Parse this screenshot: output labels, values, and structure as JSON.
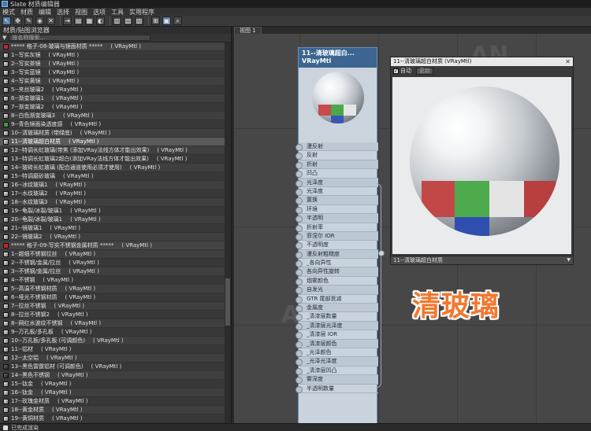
{
  "window": {
    "title": "Slate 材质编辑器"
  },
  "menu": [
    "模式",
    "材质",
    "编辑",
    "选择",
    "视图",
    "选项",
    "工具",
    "实用程序"
  ],
  "toolbar": {
    "buttons": [
      "选择",
      "平移",
      "吸管",
      "指定",
      "删除",
      "移动子对象",
      "隐藏",
      "显示背景",
      "显示贴图",
      "布局",
      "全部布局",
      "子对象",
      "导航",
      "搜索"
    ]
  },
  "left_panel": {
    "header": "材质/贴图浏览器",
    "search_placeholder": "按名称搜索...",
    "items": [
      {
        "label": "***** 格子-08-玻璃与镜面材质 *****",
        "type": "( VRayMtl )",
        "swatch": "red",
        "group": true
      },
      {
        "label": "1--写实灰镜",
        "type": "( VRayMtl )",
        "swatch": "sphere"
      },
      {
        "label": "2--写实茶镜",
        "type": "( VRayMtl )",
        "swatch": "sphere"
      },
      {
        "label": "3--写实蓝镜",
        "type": "( VRayMtl )",
        "swatch": "sphere"
      },
      {
        "label": "4--写实黄镜",
        "type": "( VRayMtl )",
        "swatch": "sphere"
      },
      {
        "label": "5--夹丝玻璃2",
        "type": "( VRayMtl )",
        "swatch": "sphere"
      },
      {
        "label": "6--渐变玻璃1",
        "type": "( VRayMtl )",
        "swatch": "sphere"
      },
      {
        "label": "7--渐变玻璃2",
        "type": "( VRayMtl )",
        "swatch": "sphere"
      },
      {
        "label": "8--白色渐变玻璃3",
        "type": "( VRayMtl )",
        "swatch": "sphere"
      },
      {
        "label": "9--青色镜面染透度感",
        "type": "( VRayMtl )",
        "swatch": "green"
      },
      {
        "label": "10--清玻璃材质 (带绿底)",
        "type": "( VRayMtl )",
        "swatch": "sphere"
      },
      {
        "label": "11--清玻璃超白材质",
        "type": "( VRayMtl )",
        "swatch": "sphere",
        "selected": true
      },
      {
        "label": "12--特调长虹玻璃(带焦 (添加VRay法线方体才能出效果)",
        "type": "( VRayMtl )",
        "swatch": "sphere"
      },
      {
        "label": "13--特调长虹玻璃2超白(添加VRay法线方体才能出效果)",
        "type": "( VRayMtl )",
        "swatch": "sphere"
      },
      {
        "label": "14--玻砖长虹玻璃 (配合通道使用必须才使用)",
        "type": "( VRayMtl )",
        "swatch": "sphere"
      },
      {
        "label": "15--特调磨砂玻璃",
        "type": "( VRayMtl )",
        "swatch": "sphere"
      },
      {
        "label": "16--冰纹玻璃1",
        "type": "( VRayMtl )",
        "swatch": "sphere"
      },
      {
        "label": "17--水纹玻璃2",
        "type": "( VRayMtl )",
        "swatch": "sphere"
      },
      {
        "label": "18--水纹玻璃3",
        "type": "( VRayMtl )",
        "swatch": "sphere"
      },
      {
        "label": "19--龟裂/冰裂/玻璃1",
        "type": "( VRayMtl )",
        "swatch": "sphere"
      },
      {
        "label": "20--龟裂/冰裂/玻璃1",
        "type": "( VRayMtl )",
        "swatch": "sphere"
      },
      {
        "label": "21--镜玻璃1",
        "type": "( VRayMtl )",
        "swatch": "sphere"
      },
      {
        "label": "22--镜玻璃2",
        "type": "( VRayMtl )",
        "swatch": "sphere"
      },
      {
        "label": "***** 格子-09-写实不锈钢金属材质 *****",
        "type": "( VRayMtl )",
        "swatch": "red",
        "group": true
      },
      {
        "label": "1--超细不锈钢拉丝",
        "type": "( VRayMtl )",
        "swatch": "sphere"
      },
      {
        "label": "2--不锈钢/金属/拉丝",
        "type": "( VRayMtl )",
        "swatch": "sphere"
      },
      {
        "label": "3--不锈钢/金属/拉丝",
        "type": "( VRayMtl )",
        "swatch": "sphere"
      },
      {
        "label": "4--不锈钢",
        "type": "( VRayMtl )",
        "swatch": "sphere"
      },
      {
        "label": "5--高温不锈钢材质",
        "type": "( VRayMtl )",
        "swatch": "sphere"
      },
      {
        "label": "6--哑光不锈钢材质",
        "type": "( VRayMtl )",
        "swatch": "sphere"
      },
      {
        "label": "7--拉丝不锈钢",
        "type": "( VRayMtl )",
        "swatch": "sphere"
      },
      {
        "label": "8--拉丝不锈钢2",
        "type": "( VRayMtl )",
        "swatch": "sphere"
      },
      {
        "label": "8--网红水波纹不锈钢",
        "type": "( VRayMtl )",
        "swatch": "sphere"
      },
      {
        "label": "9--万孔板/多孔板",
        "type": "( VRayMtl )",
        "swatch": "sphere"
      },
      {
        "label": "10--万孔板/多孔板 (可调颜色)",
        "type": "( VRayMtl )",
        "swatch": "sphere"
      },
      {
        "label": "11--铝材",
        "type": "( VRayMtl )",
        "swatch": "sphere"
      },
      {
        "label": "12--太空铝",
        "type": "( VRayMtl )",
        "swatch": "sphere"
      },
      {
        "label": "13--黑色雷霆铝材 (可调颜色)",
        "type": "( VRayMtl )",
        "swatch": "dark"
      },
      {
        "label": "14--黑色不锈钢",
        "type": "( VRayMtl )",
        "swatch": "dark"
      },
      {
        "label": "15--钛金",
        "type": "( VRayMtl )",
        "swatch": "sphere"
      },
      {
        "label": "16--钛金",
        "type": "( VRayMtl )",
        "swatch": "sphere"
      },
      {
        "label": "17--玫瑰金材质",
        "type": "( VRayMtl )",
        "swatch": "sphere"
      },
      {
        "label": "18--黄金材质",
        "type": "( VRayMtl )",
        "swatch": "sphere"
      },
      {
        "label": "19--黄铜材质",
        "type": "( VRayMtl )",
        "swatch": "sphere"
      },
      {
        "label": "20--香槟金材质",
        "type": "( VRayMtl )",
        "swatch": "sphere"
      }
    ]
  },
  "view_tab": "视图 1",
  "node": {
    "title": "11--清玻璃超白...",
    "subtitle": "VRayMtl",
    "slots": [
      "漫反射",
      "反射",
      "折射",
      "凹凸",
      "光泽度",
      "光泽度",
      "置换",
      "环境",
      "半透明",
      "折射率",
      "菲涅尔 IOR",
      "不透明度",
      "漫反射粗糙度",
      "_各向异性",
      "各向异性旋转",
      "烟雾颜色",
      "自发光",
      "GTR 尾部衰减",
      "金属度",
      "_清漆层数量",
      "_清漆层光泽度",
      "_清漆层 IOR",
      "_清漆层颜色",
      "_光泽颜色",
      "_光泽光泽度",
      "_清漆层凹凸",
      "雾深度",
      "半透明数量"
    ]
  },
  "preview_window": {
    "title": "11--清玻璃超白材质 (VRayMtl)",
    "auto_label": "自动",
    "update_label": "更新",
    "footer": "11--清玻璃超白材质"
  },
  "caption": "清玻璃",
  "watermark": "AN",
  "statusbar": {
    "text": "已完成渲染"
  }
}
